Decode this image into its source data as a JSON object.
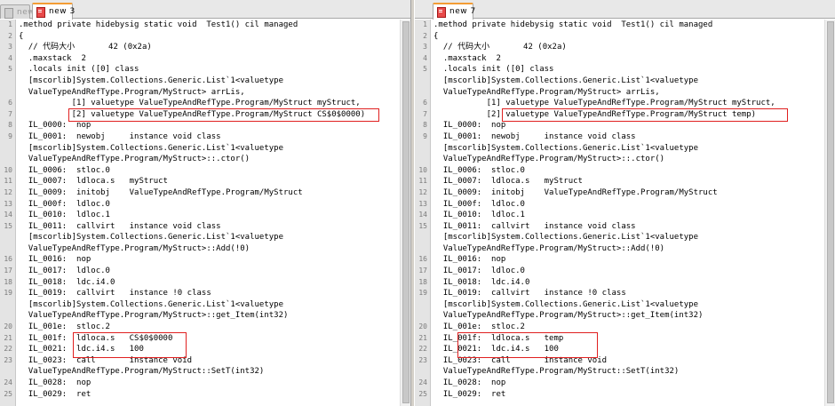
{
  "left": {
    "tabs": [
      {
        "label": "new",
        "active": false
      },
      {
        "label": "new  3",
        "active": true
      }
    ],
    "lines": [
      {
        "n": "1",
        "t": ".method private hidebysig static void  Test1() cil managed"
      },
      {
        "n": "2",
        "t": "{"
      },
      {
        "n": "3",
        "t": "  // 代码大小       42 (0x2a)"
      },
      {
        "n": "4",
        "t": "  .maxstack  2"
      },
      {
        "n": "5",
        "t": "  .locals init ([0] class"
      },
      {
        "n": "",
        "t": "  [mscorlib]System.Collections.Generic.List`1<valuetype"
      },
      {
        "n": "",
        "t": "  ValueTypeAndRefType.Program/MyStruct> arrLis,"
      },
      {
        "n": "6",
        "t": "           [1] valuetype ValueTypeAndRefType.Program/MyStruct myStruct,"
      },
      {
        "n": "7",
        "t": "           [2] valuetype ValueTypeAndRefType.Program/MyStruct CS$0$0000)"
      },
      {
        "n": "8",
        "t": "  IL_0000:  nop"
      },
      {
        "n": "9",
        "t": "  IL_0001:  newobj     instance void class"
      },
      {
        "n": "",
        "t": "  [mscorlib]System.Collections.Generic.List`1<valuetype"
      },
      {
        "n": "",
        "t": "  ValueTypeAndRefType.Program/MyStruct>::.ctor()"
      },
      {
        "n": "10",
        "t": "  IL_0006:  stloc.0"
      },
      {
        "n": "11",
        "t": "  IL_0007:  ldloca.s   myStruct"
      },
      {
        "n": "12",
        "t": "  IL_0009:  initobj    ValueTypeAndRefType.Program/MyStruct"
      },
      {
        "n": "13",
        "t": "  IL_000f:  ldloc.0"
      },
      {
        "n": "14",
        "t": "  IL_0010:  ldloc.1"
      },
      {
        "n": "15",
        "t": "  IL_0011:  callvirt   instance void class"
      },
      {
        "n": "",
        "t": "  [mscorlib]System.Collections.Generic.List`1<valuetype"
      },
      {
        "n": "",
        "t": "  ValueTypeAndRefType.Program/MyStruct>::Add(!0)"
      },
      {
        "n": "16",
        "t": "  IL_0016:  nop"
      },
      {
        "n": "17",
        "t": "  IL_0017:  ldloc.0"
      },
      {
        "n": "18",
        "t": "  IL_0018:  ldc.i4.0"
      },
      {
        "n": "19",
        "t": "  IL_0019:  callvirt   instance !0 class"
      },
      {
        "n": "",
        "t": "  [mscorlib]System.Collections.Generic.List`1<valuetype"
      },
      {
        "n": "",
        "t": "  ValueTypeAndRefType.Program/MyStruct>::get_Item(int32)"
      },
      {
        "n": "20",
        "t": "  IL_001e:  stloc.2"
      },
      {
        "n": "21",
        "t": "  IL_001f:  ldloca.s   CS$0$0000"
      },
      {
        "n": "22",
        "t": "  IL_0021:  ldc.i4.s   100"
      },
      {
        "n": "23",
        "t": "  IL_0023:  call       instance void"
      },
      {
        "n": "",
        "t": "  ValueTypeAndRefType.Program/MyStruct::SetT(int32)"
      },
      {
        "n": "24",
        "t": "  IL_0028:  nop"
      },
      {
        "n": "25",
        "t": "  IL_0029:  ret"
      }
    ]
  },
  "right": {
    "tabs": [
      {
        "label": "new  7",
        "active": true
      }
    ],
    "lines": [
      {
        "n": "1",
        "t": ".method private hidebysig static void  Test1() cil managed"
      },
      {
        "n": "2",
        "t": "{"
      },
      {
        "n": "3",
        "t": "  // 代码大小       42 (0x2a)"
      },
      {
        "n": "4",
        "t": "  .maxstack  2"
      },
      {
        "n": "5",
        "t": "  .locals init ([0] class"
      },
      {
        "n": "",
        "t": "  [mscorlib]System.Collections.Generic.List`1<valuetype"
      },
      {
        "n": "",
        "t": "  ValueTypeAndRefType.Program/MyStruct> arrLis,"
      },
      {
        "n": "6",
        "t": "           [1] valuetype ValueTypeAndRefType.Program/MyStruct myStruct,"
      },
      {
        "n": "7",
        "t": "           [2] valuetype ValueTypeAndRefType.Program/MyStruct temp)"
      },
      {
        "n": "8",
        "t": "  IL_0000:  nop"
      },
      {
        "n": "9",
        "t": "  IL_0001:  newobj     instance void class"
      },
      {
        "n": "",
        "t": "  [mscorlib]System.Collections.Generic.List`1<valuetype"
      },
      {
        "n": "",
        "t": "  ValueTypeAndRefType.Program/MyStruct>::.ctor()"
      },
      {
        "n": "10",
        "t": "  IL_0006:  stloc.0"
      },
      {
        "n": "11",
        "t": "  IL_0007:  ldloca.s   myStruct"
      },
      {
        "n": "12",
        "t": "  IL_0009:  initobj    ValueTypeAndRefType.Program/MyStruct"
      },
      {
        "n": "13",
        "t": "  IL_000f:  ldloc.0"
      },
      {
        "n": "14",
        "t": "  IL_0010:  ldloc.1"
      },
      {
        "n": "15",
        "t": "  IL_0011:  callvirt   instance void class"
      },
      {
        "n": "",
        "t": "  [mscorlib]System.Collections.Generic.List`1<valuetype"
      },
      {
        "n": "",
        "t": "  ValueTypeAndRefType.Program/MyStruct>::Add(!0)"
      },
      {
        "n": "16",
        "t": "  IL_0016:  nop"
      },
      {
        "n": "17",
        "t": "  IL_0017:  ldloc.0"
      },
      {
        "n": "18",
        "t": "  IL_0018:  ldc.i4.0"
      },
      {
        "n": "19",
        "t": "  IL_0019:  callvirt   instance !0 class"
      },
      {
        "n": "",
        "t": "  [mscorlib]System.Collections.Generic.List`1<valuetype"
      },
      {
        "n": "",
        "t": "  ValueTypeAndRefType.Program/MyStruct>::get_Item(int32)"
      },
      {
        "n": "20",
        "t": "  IL_001e:  stloc.2"
      },
      {
        "n": "21",
        "t": "  IL_001f:  ldloca.s   temp"
      },
      {
        "n": "22",
        "t": "  IL_0021:  ldc.i4.s   100"
      },
      {
        "n": "23",
        "t": "  IL_0023:  call       instance void"
      },
      {
        "n": "",
        "t": "  ValueTypeAndRefType.Program/MyStruct::SetT(int32)"
      },
      {
        "n": "24",
        "t": "  IL_0028:  nop"
      },
      {
        "n": "25",
        "t": "  IL_0029:  ret"
      }
    ]
  },
  "colors": {
    "highlight_box": "#e02020",
    "active_tab_accent": "#f39c35",
    "file_icon": "#e84a4a",
    "line_number": "#7a7a7a"
  }
}
